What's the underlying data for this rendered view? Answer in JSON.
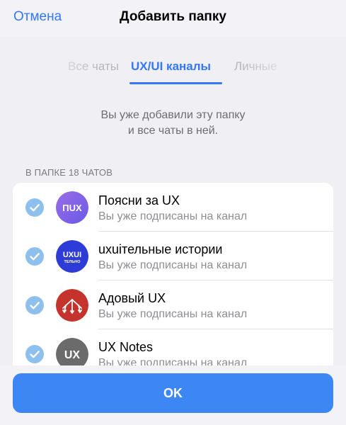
{
  "header": {
    "cancel_label": "Отмена",
    "title": "Добавить папку"
  },
  "tabs": [
    {
      "label": "Все чаты",
      "state": "partially-hidden"
    },
    {
      "label": "UX/UI каналы",
      "state": "active"
    },
    {
      "label": "Личные",
      "state": "partially-hidden"
    }
  ],
  "info": {
    "line1": "Вы уже добавили эту папку",
    "line2": "и все чаты в ней."
  },
  "section_label": "В ПАПКЕ 18 ЧАТОВ",
  "chats": [
    {
      "title": "Поясни за UX",
      "subtitle": "Вы уже подписаны на канал",
      "avatar_text": "ПUX",
      "avatar_icon": "purple-gradient-avatar",
      "checked": true
    },
    {
      "title": "uxuiтельные истории",
      "subtitle": "Вы уже подписаны на канал",
      "avatar_text": "UXUI",
      "avatar_text2": "ТЕЛЬНО",
      "avatar_icon": "blue-circle-avatar",
      "checked": true
    },
    {
      "title": "Адовый UX",
      "subtitle": "Вы уже подписаны на канал",
      "avatar_icon": "red-trident-avatar",
      "checked": true
    },
    {
      "title": "UX Notes",
      "subtitle": "Вы уже подписаны на канал",
      "avatar_text": "UX",
      "avatar_icon": "gray-circle-avatar",
      "checked": true
    }
  ],
  "ok_label": "OK",
  "colors": {
    "accent": "#3478f6",
    "button": "#3d87f5",
    "check": "#8ec0ee",
    "background": "#efeff4"
  }
}
